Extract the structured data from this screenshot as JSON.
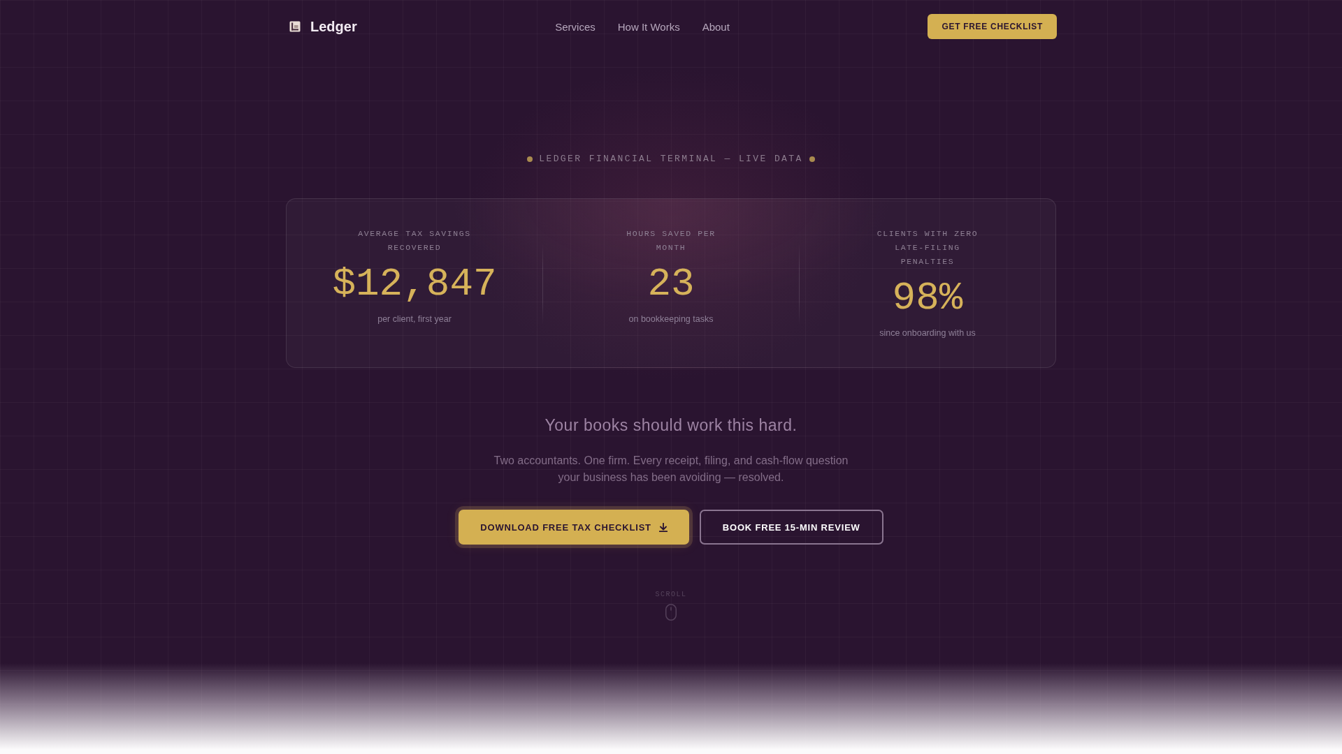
{
  "nav": {
    "brand": "Ledger",
    "links": [
      "Services",
      "How It Works",
      "About"
    ],
    "cta": "GET FREE CHECKLIST"
  },
  "hero": {
    "eyebrow": "LEDGER FINANCIAL TERMINAL — LIVE DATA",
    "stats": [
      {
        "label": "AVERAGE TAX SAVINGS RECOVERED",
        "value": "$12,847",
        "note": "per client, first year"
      },
      {
        "label": "HOURS SAVED PER MONTH",
        "value": "23",
        "note": "on bookkeeping tasks"
      },
      {
        "label": "CLIENTS WITH ZERO LATE-FILING PENALTIES",
        "value": "98%",
        "note": "since onboarding with us"
      }
    ],
    "headline": "Your books should work this hard.",
    "body": "Two accountants. One firm. Every receipt, filing, and cash-flow question your business has been avoiding — resolved.",
    "buttons": [
      {
        "label": "DOWNLOAD FREE TAX CHECKLIST",
        "kind": "primary"
      },
      {
        "label": "BOOK FREE 15-MIN REVIEW",
        "kind": "secondary"
      }
    ],
    "scroll_hint": "SCROLL"
  }
}
